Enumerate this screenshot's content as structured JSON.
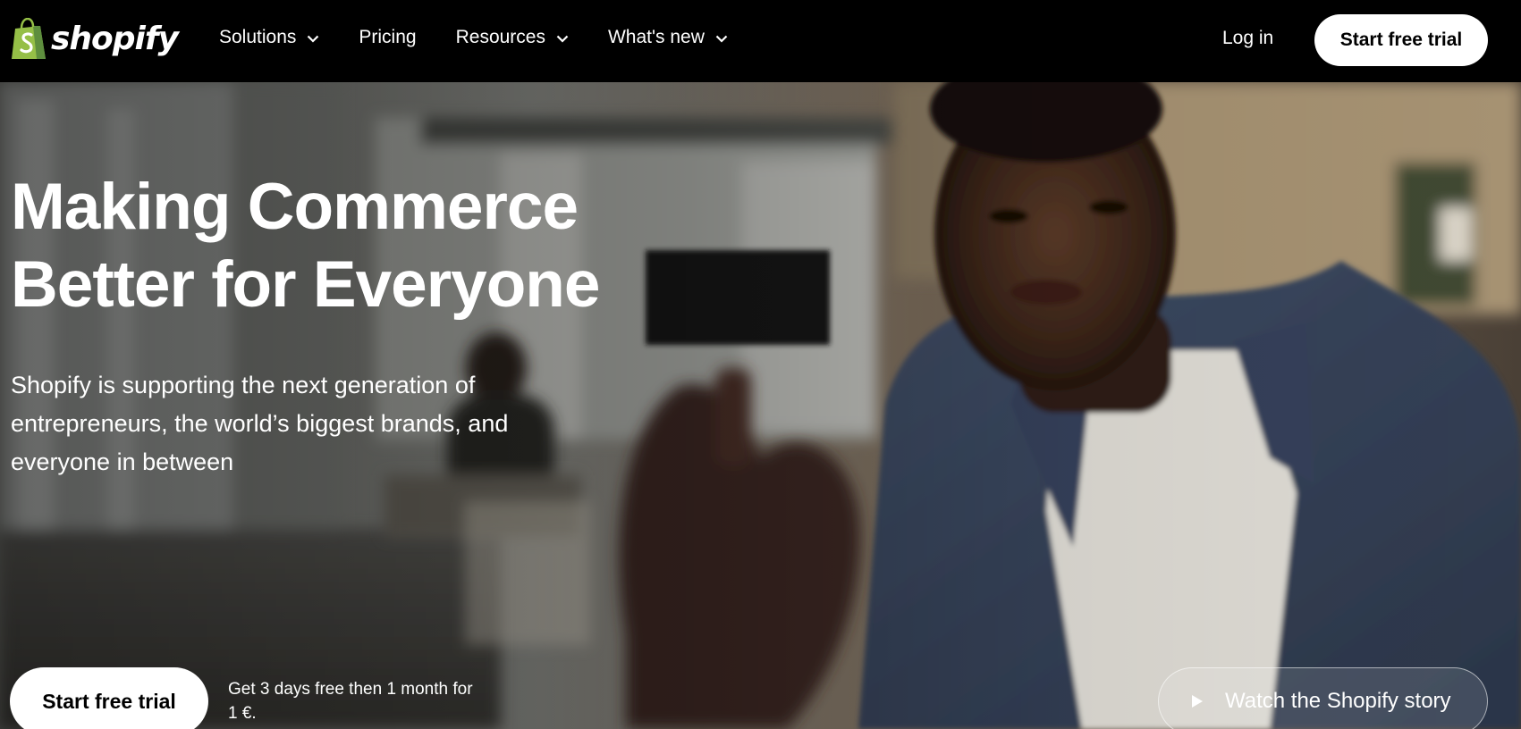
{
  "nav": {
    "logo_text": "shopify",
    "links": [
      {
        "label": "Solutions",
        "has_dropdown": true
      },
      {
        "label": "Pricing",
        "has_dropdown": false
      },
      {
        "label": "Resources",
        "has_dropdown": true
      },
      {
        "label": "What's new",
        "has_dropdown": true
      }
    ],
    "login_label": "Log in",
    "cta_label": "Start free trial"
  },
  "hero": {
    "headline_line1": "Making Commerce",
    "headline_line2": "Better for Everyone",
    "subtext": "Shopify is supporting the next generation of entrepreneurs, the world’s biggest brands, and everyone in between",
    "cta_label": "Start free trial",
    "trial_note": "Get 3 days free then 1 month for 1 €.",
    "video_button_label": "Watch the Shopify story",
    "video_button_icon": "play-icon"
  },
  "colors": {
    "nav_bg": "#000000",
    "brand_green": "#95BF47",
    "button_bg": "#FFFFFF",
    "text_on_dark": "#FFFFFF"
  }
}
